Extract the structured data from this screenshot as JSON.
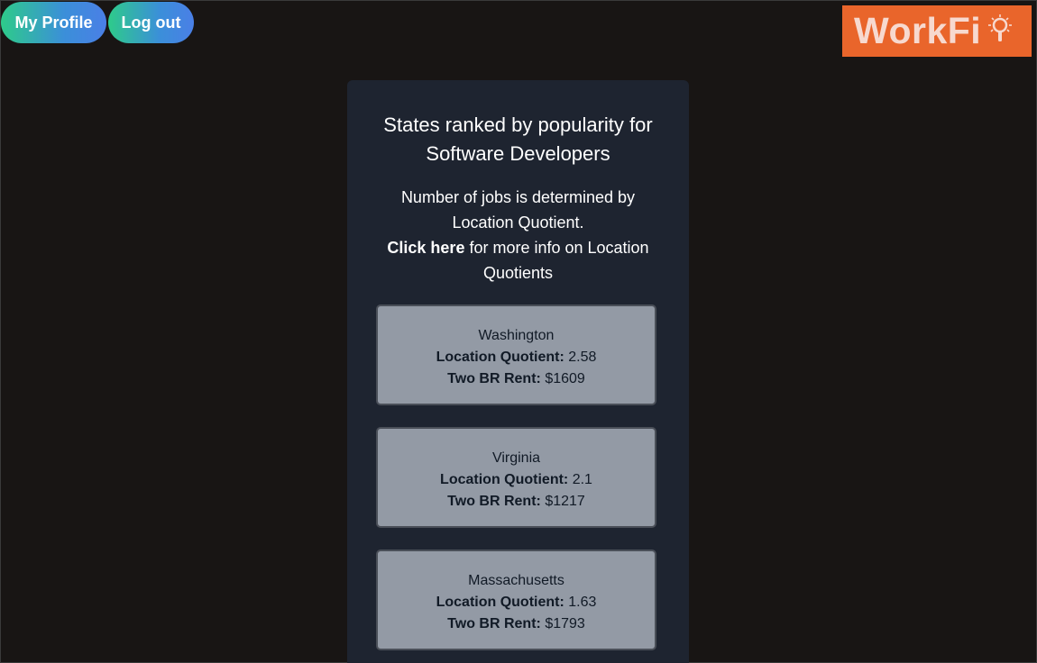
{
  "nav": {
    "profile_label": "My Profile",
    "logout_label": "Log out"
  },
  "logo": {
    "text": "WorkFi",
    "icon": "lightbulb-icon",
    "color": "#e9652b"
  },
  "panel": {
    "title": "States ranked by popularity for Software Developers",
    "info_line": "Number of jobs is determined by Location Quotient.",
    "link_text": "Click here",
    "link_suffix": " for more info on Location Quotients",
    "lq_label": "Location Quotient:",
    "rent_label": "Two BR Rent:",
    "states": [
      {
        "name": "Washington",
        "lq": "2.58",
        "rent": "$1609"
      },
      {
        "name": "Virginia",
        "lq": "2.1",
        "rent": "$1217"
      },
      {
        "name": "Massachusetts",
        "lq": "1.63",
        "rent": "$1793"
      }
    ]
  }
}
